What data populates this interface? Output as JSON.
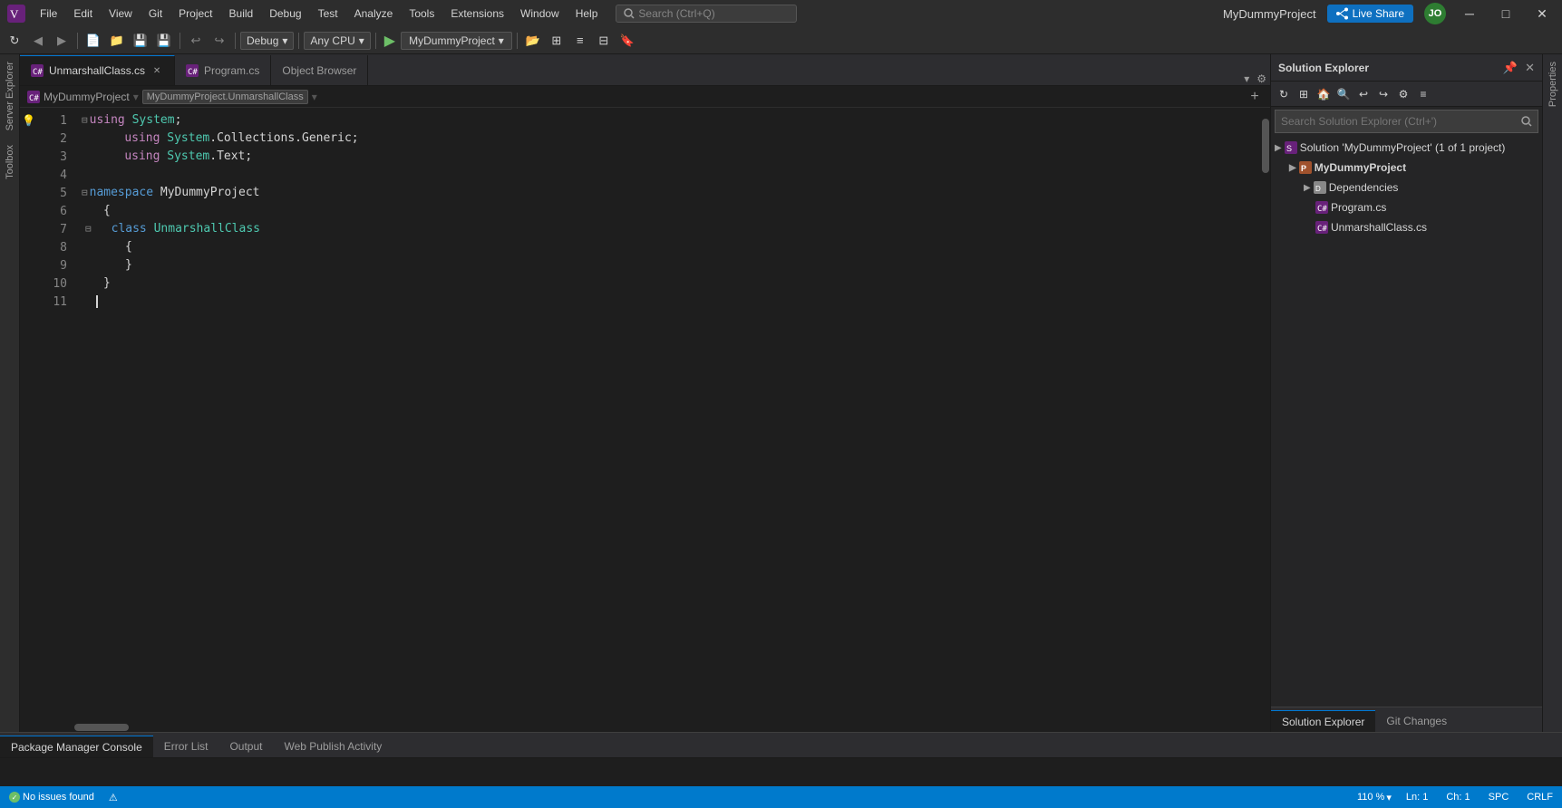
{
  "titleBar": {
    "title": "MyDummyProject",
    "menu": [
      "File",
      "Edit",
      "View",
      "Git",
      "Project",
      "Build",
      "Debug",
      "Test",
      "Analyze",
      "Tools",
      "Extensions",
      "Window",
      "Help"
    ],
    "search_placeholder": "Search (Ctrl+Q)",
    "live_share_label": "Live Share",
    "minimize_icon": "─",
    "maximize_icon": "□",
    "close_icon": "✕"
  },
  "toolbar": {
    "config_label": "Debug",
    "platform_label": "Any CPU",
    "project_label": "MyDummyProject"
  },
  "tabs": [
    {
      "label": "UnmarshallClass.cs",
      "active": true,
      "modified": false
    },
    {
      "label": "Program.cs",
      "active": false,
      "modified": false
    },
    {
      "label": "Object Browser",
      "active": false,
      "modified": false
    }
  ],
  "breadcrumb": {
    "project": "MyDummyProject",
    "class": "MyDummyProject.UnmarshallClass"
  },
  "code": {
    "lines": [
      {
        "num": 1,
        "text": "⊟using System;",
        "has_indicator": true
      },
      {
        "num": 2,
        "text": "    using System.Collections.Generic;",
        "has_indicator": false
      },
      {
        "num": 3,
        "text": "    using System.Text;",
        "has_indicator": false
      },
      {
        "num": 4,
        "text": "",
        "has_indicator": false
      },
      {
        "num": 5,
        "text": "⊟  namespace MyDummyProject",
        "has_indicator": false
      },
      {
        "num": 6,
        "text": "    {",
        "has_indicator": false
      },
      {
        "num": 7,
        "text": "  ⊟     class UnmarshallClass",
        "has_indicator": false
      },
      {
        "num": 8,
        "text": "        {",
        "has_indicator": false
      },
      {
        "num": 9,
        "text": "        }",
        "has_indicator": false
      },
      {
        "num": 10,
        "text": "    }",
        "has_indicator": false
      },
      {
        "num": 11,
        "text": "",
        "has_indicator": false
      }
    ]
  },
  "solutionExplorer": {
    "title": "Solution Explorer",
    "search_placeholder": "Search Solution Explorer (Ctrl+')",
    "items": [
      {
        "indent": 0,
        "label": "Solution 'MyDummyProject' (1 of 1 project)",
        "type": "solution",
        "expanded": true
      },
      {
        "indent": 1,
        "label": "MyDummyProject",
        "type": "project",
        "expanded": true,
        "bold": true
      },
      {
        "indent": 2,
        "label": "Dependencies",
        "type": "folder",
        "expanded": false
      },
      {
        "indent": 2,
        "label": "Program.cs",
        "type": "file-cs"
      },
      {
        "indent": 2,
        "label": "UnmarshallClass.cs",
        "type": "file-cs"
      }
    ]
  },
  "bottomPanelTabs": [
    "Package Manager Console",
    "Error List",
    "Output",
    "Web Publish Activity"
  ],
  "statusBar": {
    "no_issues": "No issues found",
    "line": "Ln: 1",
    "col": "Ch: 1",
    "encoding": "SPC",
    "line_endings": "CRLF",
    "zoom": "110 %"
  },
  "bottomTabs": [
    "Solution Explorer",
    "Git Changes"
  ],
  "sidebarLabels": [
    "Server Explorer",
    "Toolbox"
  ]
}
